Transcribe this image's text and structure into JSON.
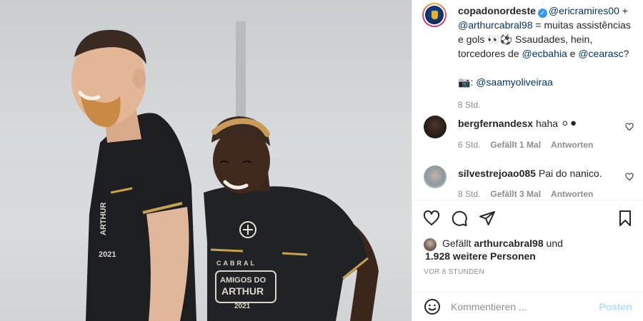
{
  "post": {
    "username": "copadonordeste",
    "caption_parts": {
      "mention1": "@ericramires00",
      "plus": " +",
      "mention2": "@arthurcabral98",
      "text1": " = muitas assistências e gols ",
      "emojis1": "👀⚽",
      "text2": " Ssaudades, hein, torcedores de ",
      "mention3": "@ecbahia",
      "text3": " e ",
      "mention4": "@cearasc",
      "text4": "?",
      "camera": "📷",
      "text5": ": ",
      "mention5": "@saamyoliveiraa"
    },
    "caption_time": "8 Std."
  },
  "comments": [
    {
      "username": "bergfernandesx",
      "text": "haha",
      "emojis": "⚪⚫",
      "time": "6 Std.",
      "likes": "Gefällt 1 Mal",
      "reply": "Antworten"
    },
    {
      "username": "silvestrejoao085",
      "text": "Pai do nanico.",
      "time": "8 Std.",
      "likes": "Gefällt 3 Mal",
      "reply": "Antworten"
    }
  ],
  "likes": {
    "prefix": "Gefällt",
    "user": "arthurcabral98",
    "suffix": "und",
    "others": "1.928 weitere Personen"
  },
  "posted": "VOR 8 STUNDEN",
  "comment_input": {
    "placeholder": "Kommentieren ...",
    "post_label": "Posten"
  },
  "photo": {
    "jersey_text_1": "AMIGOS DO",
    "jersey_text_2": "ARTHUR",
    "jersey_year": "2021",
    "jersey_brand": "CABRAL",
    "colors": {
      "jersey": "#1f2124",
      "trim": "#c9a24a"
    }
  },
  "icons": [
    "heart-icon",
    "comment-icon",
    "share-icon",
    "bookmark-icon",
    "emoji-icon",
    "verified-icon",
    "like-comment-icon"
  ]
}
